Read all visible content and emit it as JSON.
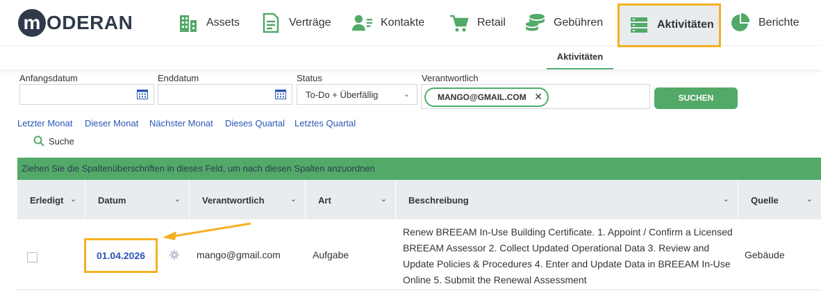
{
  "brand": {
    "logo_letter": "m",
    "logo_text": "ODERAN"
  },
  "nav": {
    "items": [
      {
        "label": "Assets",
        "icon": "building-icon"
      },
      {
        "label": "Verträge",
        "icon": "document-icon"
      },
      {
        "label": "Kontakte",
        "icon": "contacts-icon"
      },
      {
        "label": "Retail",
        "icon": "cart-icon"
      },
      {
        "label": "Gebühren",
        "icon": "coins-icon"
      },
      {
        "label": "Aktivitäten",
        "icon": "list-icon",
        "active": true
      },
      {
        "label": "Berichte",
        "icon": "pie-chart-icon"
      }
    ],
    "accent": "#4caf6a",
    "highlight": "#f5b021"
  },
  "subnav": {
    "active_tab": "Aktivitäten"
  },
  "filters": {
    "start_label": "Anfangsdatum",
    "start_value": "",
    "end_label": "Enddatum",
    "end_value": "",
    "status_label": "Status",
    "status_value": "To-Do + Überfällig",
    "responsible_label": "Verantwortlich",
    "responsible_chip": "MANGO@GMAIL.COM",
    "search_button": "SUCHEN"
  },
  "quick_links": [
    "Letzter Monat",
    "Dieser Monat",
    "Nächster Monat",
    "Dieses Quartal",
    "Letztes Quartal"
  ],
  "search_link": "Suche",
  "grid": {
    "group_hint": "Ziehen Sie die Spaltenüberschriften in dieses Feld, um nach diesen Spalten anzuordnen",
    "columns": [
      "Erledigt",
      "Datum",
      "Verantwortlich",
      "Art",
      "Beschreibung",
      "Quelle"
    ],
    "rows": [
      {
        "done": false,
        "date": "01.04.2026",
        "responsible": "mango@gmail.com",
        "type": "Aufgabe",
        "description": "Renew BREEAM In-Use Building Certificate. 1. Appoint / Confirm a Licensed BREEAM Assessor 2. Collect Updated Operational Data 3. Review and Update Policies & Procedures 4. Enter and Update Data in BREEAM In-Use Online 5. Submit the Renewal Assessment",
        "source": "Gebäude"
      }
    ]
  }
}
